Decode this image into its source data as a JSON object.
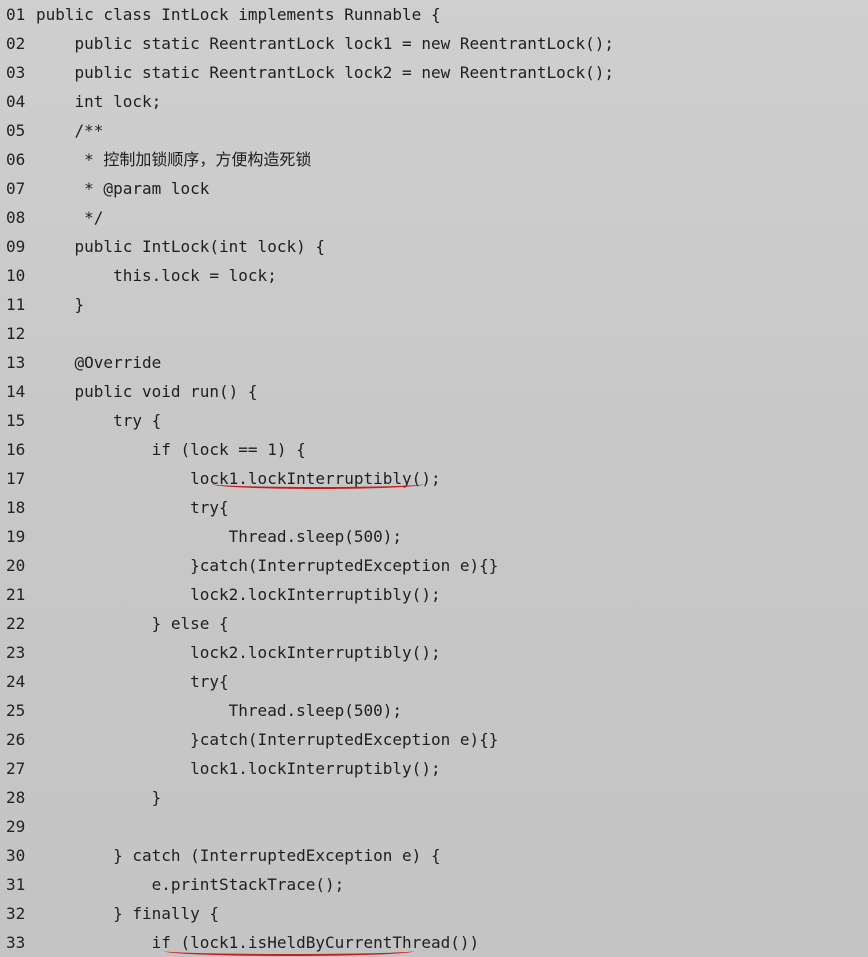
{
  "code_lines": [
    {
      "number": "01",
      "text": "public class IntLock implements Runnable {"
    },
    {
      "number": "02",
      "text": "    public static ReentrantLock lock1 = new ReentrantLock();"
    },
    {
      "number": "03",
      "text": "    public static ReentrantLock lock2 = new ReentrantLock();"
    },
    {
      "number": "04",
      "text": "    int lock;"
    },
    {
      "number": "05",
      "text": "    /**"
    },
    {
      "number": "06",
      "text": "     * 控制加锁顺序，方便构造死锁"
    },
    {
      "number": "07",
      "text": "     * @param lock"
    },
    {
      "number": "08",
      "text": "     */"
    },
    {
      "number": "09",
      "text": "    public IntLock(int lock) {"
    },
    {
      "number": "10",
      "text": "        this.lock = lock;"
    },
    {
      "number": "11",
      "text": "    }"
    },
    {
      "number": "12",
      "text": ""
    },
    {
      "number": "13",
      "text": "    @Override"
    },
    {
      "number": "14",
      "text": "    public void run() {"
    },
    {
      "number": "15",
      "text": "        try {"
    },
    {
      "number": "16",
      "text": "            if (lock == 1) {"
    },
    {
      "number": "17",
      "text": "                lock1.lockInterruptibly();"
    },
    {
      "number": "18",
      "text": "                try{"
    },
    {
      "number": "19",
      "text": "                    Thread.sleep(500);"
    },
    {
      "number": "20",
      "text": "                }catch(InterruptedException e){}"
    },
    {
      "number": "21",
      "text": "                lock2.lockInterruptibly();"
    },
    {
      "number": "22",
      "text": "            } else {"
    },
    {
      "number": "23",
      "text": "                lock2.lockInterruptibly();"
    },
    {
      "number": "24",
      "text": "                try{"
    },
    {
      "number": "25",
      "text": "                    Thread.sleep(500);"
    },
    {
      "number": "26",
      "text": "                }catch(InterruptedException e){}"
    },
    {
      "number": "27",
      "text": "                lock1.lockInterruptibly();"
    },
    {
      "number": "28",
      "text": "            }"
    },
    {
      "number": "29",
      "text": ""
    },
    {
      "number": "30",
      "text": "        } catch (InterruptedException e) {"
    },
    {
      "number": "31",
      "text": "            e.printStackTrace();"
    },
    {
      "number": "32",
      "text": "        } finally {"
    },
    {
      "number": "33",
      "text": "            if (lock1.isHeldByCurrentThread())"
    }
  ],
  "colors": {
    "page_background": "#c9c9c9",
    "code_text": "#202020",
    "annotation_underline": "#c91b1b"
  }
}
